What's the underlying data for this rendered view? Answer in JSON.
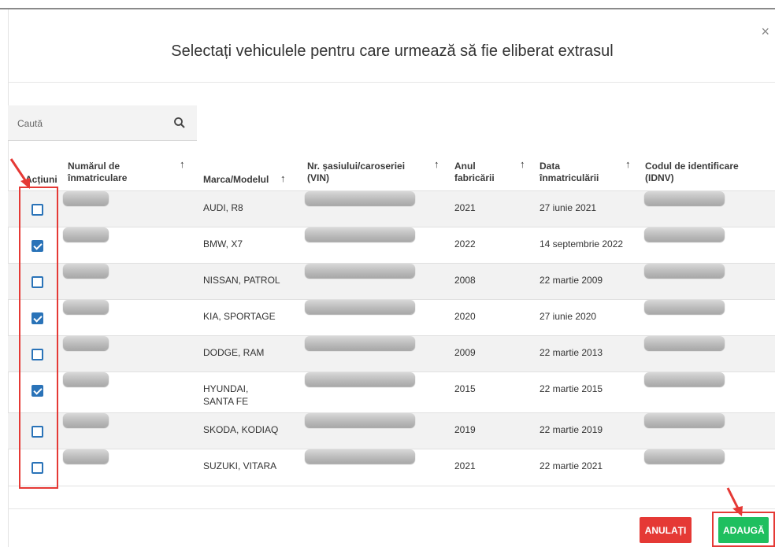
{
  "dialog": {
    "title": "Selectați vehiculele pentru care urmează să fie eliberat extrasul",
    "close_glyph": "×"
  },
  "search": {
    "placeholder": "Caută",
    "icon": "search-icon"
  },
  "table": {
    "headers": {
      "actions": "Acțiuni",
      "plate": "Numărul de înmatriculare",
      "make": "Marca/Modelul",
      "vin": "Nr. șasiului/caroseriei (VIN)",
      "year": "Anul fabricării",
      "reg_date": "Data înmatriculării",
      "idnv": "Codul de identificare (IDNV)"
    },
    "sort_glyph": "↑",
    "rows": [
      {
        "checked": false,
        "make": "AUDI, R8",
        "year": "2021",
        "reg_date": "27 iunie 2021"
      },
      {
        "checked": true,
        "make": "BMW, X7",
        "year": "2022",
        "reg_date": "14 septembrie 2022"
      },
      {
        "checked": false,
        "make": "NISSAN, PATROL",
        "year": "2008",
        "reg_date": "22 martie 2009"
      },
      {
        "checked": true,
        "make": "KIA, SPORTAGE",
        "year": "2020",
        "reg_date": "27 iunie 2020"
      },
      {
        "checked": false,
        "make": "DODGE, RAM",
        "year": "2009",
        "reg_date": "22 martie 2013"
      },
      {
        "checked": true,
        "make": "HYUNDAI, SANTA FE",
        "year": "2015",
        "reg_date": "22 martie 2015"
      },
      {
        "checked": false,
        "make": "SKODA, KODIAQ",
        "year": "2019",
        "reg_date": "22 martie 2019"
      },
      {
        "checked": false,
        "make": "SUZUKI, VITARA",
        "year": "2021",
        "reg_date": "22 martie 2021"
      }
    ]
  },
  "footer": {
    "cancel_label": "ANULAȚI",
    "add_label": "ADAUGĂ"
  },
  "colors": {
    "accent": "#2a73b8",
    "cancel": "#e53935",
    "add": "#1fbf5f",
    "annotation": "#e53935"
  }
}
